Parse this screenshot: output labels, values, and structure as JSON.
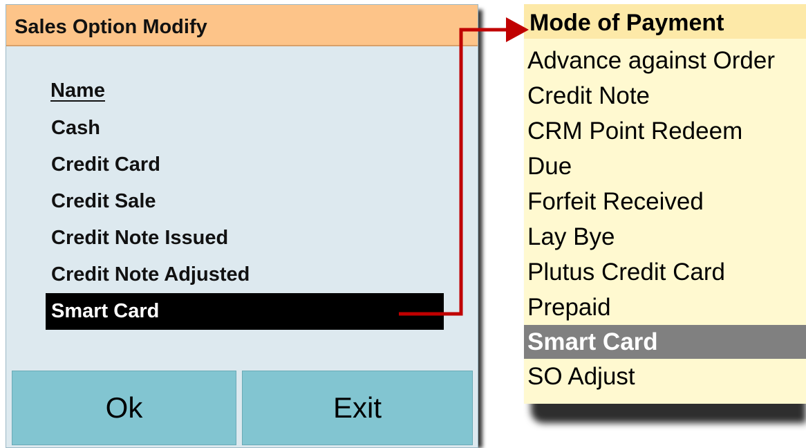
{
  "dialog": {
    "title": "Sales Option Modify",
    "list_header": "Name",
    "items": [
      {
        "label": "Cash",
        "selected": false
      },
      {
        "label": "Credit Card",
        "selected": false
      },
      {
        "label": "Credit Sale",
        "selected": false
      },
      {
        "label": "Credit Note Issued",
        "selected": false
      },
      {
        "label": "Credit Note Adjusted",
        "selected": false
      },
      {
        "label": "Smart Card",
        "selected": true
      }
    ],
    "ok_label": "Ok",
    "exit_label": "Exit"
  },
  "dropdown": {
    "header": "Mode of Payment",
    "items": [
      {
        "label": "Advance against Order",
        "selected": false
      },
      {
        "label": "Credit Note",
        "selected": false
      },
      {
        "label": "CRM Point Redeem",
        "selected": false
      },
      {
        "label": "Due",
        "selected": false
      },
      {
        "label": "Forfeit Received",
        "selected": false
      },
      {
        "label": "Lay Bye",
        "selected": false
      },
      {
        "label": "Plutus Credit Card",
        "selected": false
      },
      {
        "label": "Prepaid",
        "selected": false
      },
      {
        "label": "Smart Card",
        "selected": true
      },
      {
        "label": "SO Adjust",
        "selected": false
      }
    ]
  },
  "colors": {
    "dialog_title_bg": "#fdc489",
    "dialog_bg": "#dde9ef",
    "button_bg": "#82c5d1",
    "selected_row_bg": "#000000",
    "dropdown_bg": "#fff9d0",
    "dropdown_selected_bg": "#808080",
    "arrow": "#c00000"
  },
  "icons": {
    "connector": "red-arrow-icon"
  }
}
